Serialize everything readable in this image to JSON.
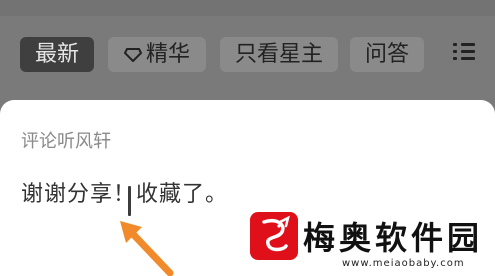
{
  "tabs": [
    {
      "label": "最新",
      "active": true
    },
    {
      "label": "精华",
      "icon": "diamond-icon",
      "active": false
    },
    {
      "label": "只看星主",
      "active": false
    },
    {
      "label": "问答",
      "active": false
    }
  ],
  "menu_icon": "list-menu-icon",
  "sheet": {
    "title": "评论听风轩",
    "input_text": "谢谢分享！收藏了。"
  },
  "watermark": {
    "name": "梅奥软件园",
    "url": "www.meiaobaby.com",
    "logo_icon": "dragon-logo-icon"
  },
  "colors": {
    "overlay": "#7a7a7a",
    "active_tab": "#3f3f3f",
    "sheet": "#ffffff",
    "arrow": "#f08a2a",
    "logo": "#e0101b"
  }
}
